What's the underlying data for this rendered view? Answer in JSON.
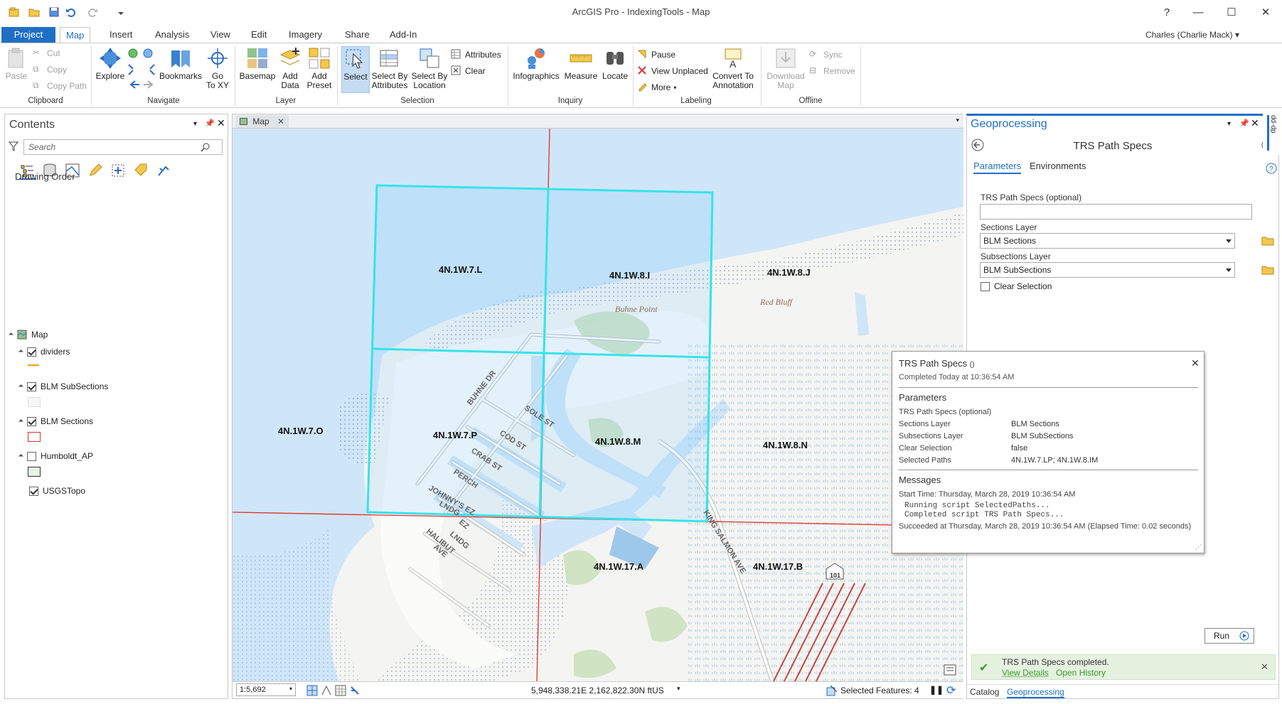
{
  "window": {
    "title": "ArcGIS Pro - IndexingTools - Map",
    "help": "?",
    "minimize": "—",
    "maximize": "☐",
    "close": "✕"
  },
  "tabs": [
    "Project",
    "Map",
    "Insert",
    "Analysis",
    "View",
    "Edit",
    "Imagery",
    "Share",
    "Add-In"
  ],
  "user": "Charles (Charlie Mack) ▾",
  "ribbon": {
    "clipboard": {
      "label": "Clipboard",
      "paste": "Paste",
      "cut": "Cut",
      "copy": "Copy",
      "copy_path": "Copy Path"
    },
    "navigate": {
      "label": "Navigate",
      "explore": "Explore",
      "bookmarks": "Bookmarks",
      "goto": "Go\nTo XY"
    },
    "layer": {
      "label": "Layer",
      "basemap": "Basemap",
      "add_data": "Add\nData",
      "add_preset": "Add\nPreset"
    },
    "selection": {
      "label": "Selection",
      "select": "Select",
      "by_attr": "Select By\nAttributes",
      "by_loc": "Select By\nLocation",
      "attributes": "Attributes",
      "clear": "Clear"
    },
    "inquiry": {
      "label": "Inquiry",
      "infographics": "Infographics",
      "measure": "Measure",
      "locate": "Locate"
    },
    "labeling": {
      "label": "Labeling",
      "pause": "Pause",
      "view_unplaced": "View Unplaced",
      "more": "More",
      "convert": "Convert To\nAnnotation"
    },
    "offline": {
      "label": "Offline",
      "download": "Download\nMap",
      "sync": "Sync",
      "remove": "Remove"
    }
  },
  "contents": {
    "title": "Contents",
    "search_placeholder": "Search",
    "drawing_order": "Drawing Order",
    "map_name": "Map",
    "layers": [
      {
        "name": "dividers",
        "checked": true
      },
      {
        "name": "BLM SubSections",
        "checked": true
      },
      {
        "name": "BLM Sections",
        "checked": true
      },
      {
        "name": "Humboldt_AP",
        "checked": false
      },
      {
        "name": "USGSTopo",
        "checked": true
      }
    ]
  },
  "map": {
    "tab": "Map",
    "scale": "1:5,692",
    "coords": "5,948,338.21E 2,162,822.30N ftUS",
    "selected_features": "Selected Features: 4",
    "section_labels": [
      "4N.1W.7.L",
      "4N.1W.8.I",
      "4N.1W.8.J",
      "4N.1W.7.O",
      "4N.1W.7.P",
      "4N.1W.8.M",
      "4N.1W.8.N",
      "4N.1W.17.A",
      "4N.1W.17.B"
    ],
    "places": [
      "Buhne Point",
      "Red Bluff"
    ],
    "streets": [
      "BUHNE DR",
      "SOLE ST",
      "COD ST",
      "CRAB ST",
      "PERCH",
      "JOHNNY'S EZ",
      "LNDG",
      "EZ",
      "LNDG",
      "HALIBUT",
      "AVE",
      "KING SALMON AVE",
      "101"
    ]
  },
  "geoprocessing": {
    "title": "Geoprocessing",
    "tool": "TRS Path Specs",
    "tab_params": "Parameters",
    "tab_env": "Environments",
    "p1_label": "TRS Path Specs (optional)",
    "p2_label": "Sections Layer",
    "p2_value": "BLM Sections",
    "p3_label": "Subsections Layer",
    "p3_value": "BLM SubSections",
    "p4_label": "Clear Selection",
    "run": "Run",
    "done_msg": "TRS Path Specs completed.",
    "view_details": "View Details",
    "open_history": "Open History",
    "bottom_tabs": [
      "Catalog",
      "Geoprocessing"
    ]
  },
  "popup": {
    "title": "TRS Path Specs",
    "title_suffix": "()",
    "completed": "Completed Today at 10:36:54 AM",
    "params_heading": "Parameters",
    "params": [
      {
        "k": "TRS Path Specs (optional)",
        "v": ""
      },
      {
        "k": "Sections Layer",
        "v": "BLM Sections"
      },
      {
        "k": "Subsections Layer",
        "v": "BLM SubSections"
      },
      {
        "k": "Clear Selection",
        "v": "false"
      },
      {
        "k": "Selected Paths",
        "v": "4N.1W.7.LP; 4N.1W.8.IM"
      }
    ],
    "messages_heading": "Messages",
    "start": "Start Time: Thursday, March 28, 2019 10:36:54 AM",
    "msg1": "Running script SelectedPaths...",
    "msg2": "Completed script TRS Path Specs...",
    "succeeded": "Succeeded at Thursday, March 28, 2019 10:36:54 AM (Elapsed Time: 0.02 seconds)"
  },
  "side_tab": "dd-dp"
}
